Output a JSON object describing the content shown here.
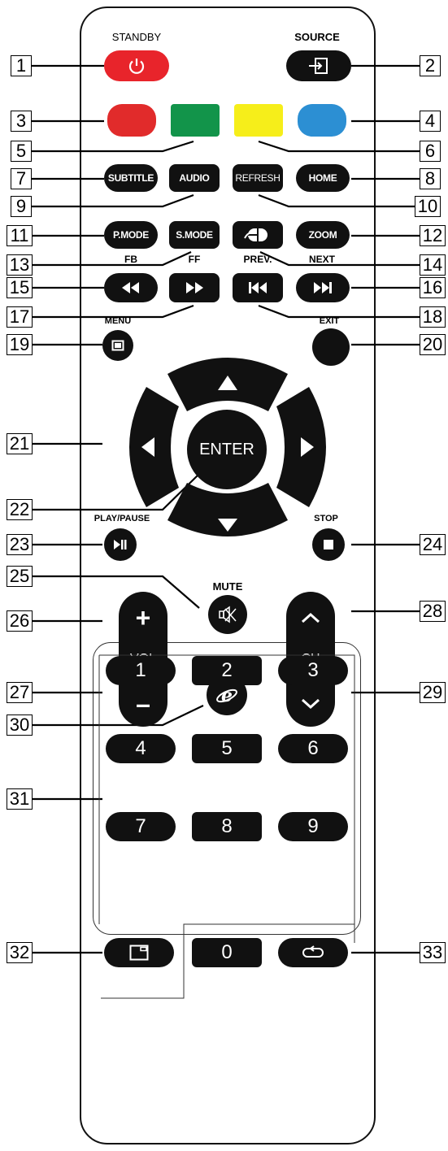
{
  "labels": {
    "standby": "STANDBY",
    "source": "SOURCE",
    "fb": "FB",
    "ff": "FF",
    "prev": "PREV.",
    "next": "NEXT",
    "menu": "MENU",
    "exit": "EXIT",
    "play_pause": "PLAY/PAUSE",
    "stop": "STOP",
    "mute": "MUTE"
  },
  "buttons": {
    "subtitle": "SUBTITLE",
    "audio": "AUDIO",
    "refresh": "REFRESH",
    "home": "HOME",
    "pmode": "P.MODE",
    "smode": "S.MODE",
    "zoom": "ZOOM",
    "enter": "ENTER",
    "vol": "VOL",
    "vol_plus": "+",
    "vol_minus": "–",
    "ch": "CH"
  },
  "digits": [
    "1",
    "2",
    "3",
    "4",
    "5",
    "6",
    "7",
    "8",
    "9",
    "0"
  ],
  "callouts": [
    "1",
    "2",
    "3",
    "4",
    "5",
    "6",
    "7",
    "8",
    "9",
    "10",
    "11",
    "12",
    "13",
    "14",
    "15",
    "16",
    "17",
    "18",
    "19",
    "20",
    "21",
    "22",
    "23",
    "24",
    "25",
    "26",
    "27",
    "28",
    "29",
    "30",
    "31",
    "32",
    "33"
  ],
  "colors": {
    "standby_red": "#e8242b",
    "red_key": "#e12b2b",
    "green_key": "#12944a",
    "yellow_key": "#f6ee1a",
    "blue_key": "#2c8fd3",
    "button_black": "#111111"
  },
  "icons": {
    "standby": "power-icon",
    "source": "input-source-icon",
    "fb": "rewind-icon",
    "ff": "fast-forward-icon",
    "prev": "skip-previous-icon",
    "next": "skip-next-icon",
    "menu": "menu-square-icon",
    "mute": "speaker-muted-icon",
    "browser": "internet-explorer-icon",
    "play_pause": "play-pause-icon",
    "stop": "stop-icon",
    "pip": "picture-in-picture-icon",
    "recall": "return-arrow-icon",
    "mouse": "mouse-icon"
  }
}
